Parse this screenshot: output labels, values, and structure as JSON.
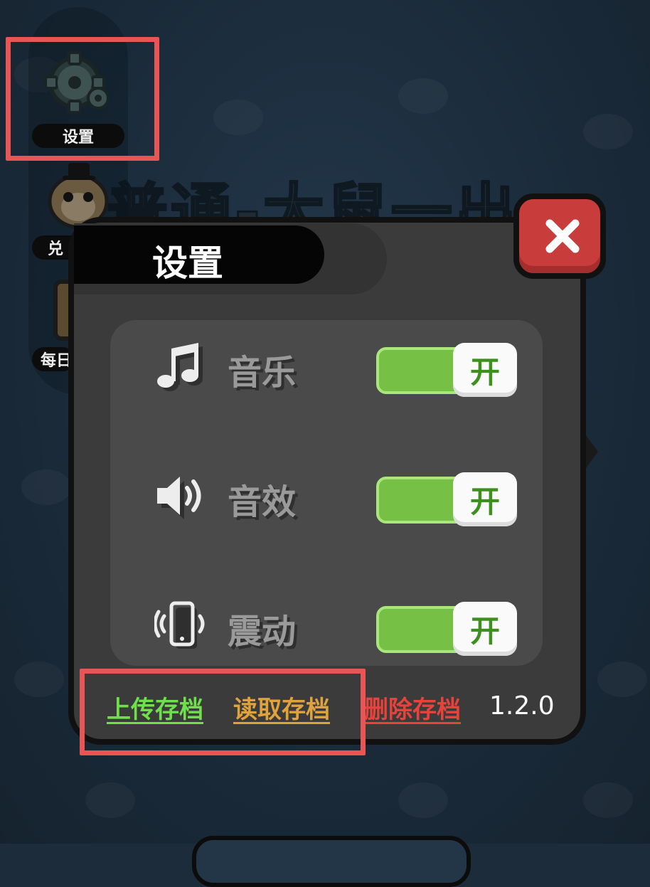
{
  "sidebar": {
    "items": [
      {
        "label": "设置",
        "icon": "gear-icon"
      },
      {
        "label": "兑",
        "icon": "hamster-icon"
      },
      {
        "label": "每日",
        "icon": "calendar-icon"
      }
    ]
  },
  "background": {
    "title": "普通-大鼠一出"
  },
  "dialog": {
    "title": "设置",
    "close_icon": "close-icon",
    "settings": [
      {
        "label": "音乐",
        "icon": "music-note-icon",
        "toggle_label": "开",
        "on": true
      },
      {
        "label": "音效",
        "icon": "speaker-icon",
        "toggle_label": "开",
        "on": true
      },
      {
        "label": "震动",
        "icon": "phone-vibrate-icon",
        "toggle_label": "开",
        "on": true
      }
    ],
    "footer": {
      "upload": "上传存档",
      "read": "读取存档",
      "delete": "删除存档",
      "version": "1.2.0"
    }
  },
  "colors": {
    "upload": "#6ee04a",
    "read": "#e0a23a",
    "delete": "#e8423b",
    "toggle_on": "#76c046",
    "close": "#c93c3c",
    "highlight": "#e85555"
  }
}
